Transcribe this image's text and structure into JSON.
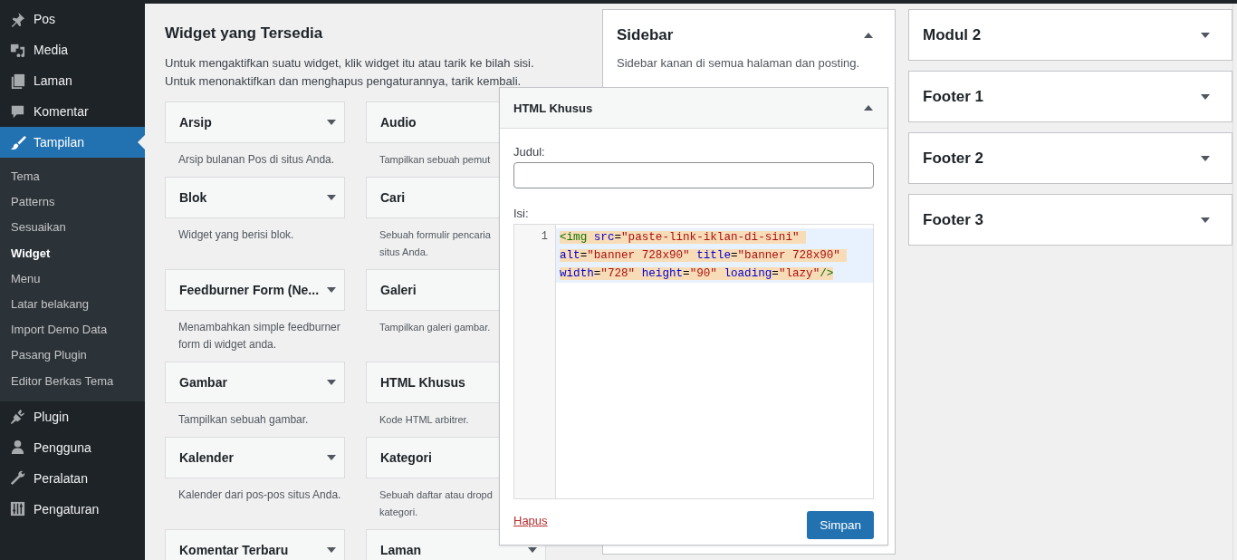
{
  "admin_menu": [
    {
      "label": "Pos",
      "selected": false
    },
    {
      "label": "Media",
      "selected": false
    },
    {
      "label": "Laman",
      "selected": false
    },
    {
      "label": "Komentar",
      "selected": false
    },
    {
      "label": "Tampilan",
      "selected": true,
      "children": [
        {
          "label": "Tema",
          "selected": false
        },
        {
          "label": "Patterns",
          "selected": false
        },
        {
          "label": "Sesuaikan",
          "selected": false
        },
        {
          "label": "Widget",
          "selected": true
        },
        {
          "label": "Menu",
          "selected": false
        },
        {
          "label": "Latar belakang",
          "selected": false
        },
        {
          "label": "Import Demo Data",
          "selected": false
        },
        {
          "label": "Pasang Plugin",
          "selected": false
        },
        {
          "label": "Editor Berkas Tema",
          "selected": false
        }
      ]
    },
    {
      "label": "Plugin",
      "selected": false
    },
    {
      "label": "Pengguna",
      "selected": false
    },
    {
      "label": "Peralatan",
      "selected": false
    },
    {
      "label": "Pengaturan",
      "selected": false
    }
  ],
  "available_widgets": {
    "title": "Widget yang Tersedia",
    "description": [
      "Untuk mengaktifkan suatu widget, klik widget itu atau tarik ke bilah sisi.",
      "Untuk menonaktifkan dan menghapus pengaturannya, tarik kembali."
    ],
    "widgets": [
      {
        "name": "Arsip",
        "description": "Arsip bulanan Pos di situs Anda.",
        "expanded": false
      },
      {
        "name": "Audio",
        "description": "Tampilkan sebuah pemut"
      },
      {
        "name": "Blok",
        "description": "Widget yang berisi blok.",
        "expanded": false
      },
      {
        "name": "Cari",
        "description": "Sebuah formulir pencaria situs Anda."
      },
      {
        "name": "Feedburner Form (Ne...",
        "description": "Menambahkan simple feedburner form di widget anda.",
        "expanded": false
      },
      {
        "name": "Galeri",
        "description": "Tampilkan galeri gambar."
      },
      {
        "name": "Gambar",
        "description": "Tampilkan sebuah gambar.",
        "expanded": false
      },
      {
        "name": "HTML Khusus",
        "description": "Kode HTML arbitrer."
      },
      {
        "name": "Kalender",
        "description": "Kalender dari pos-pos situs Anda.",
        "expanded": false
      },
      {
        "name": "Kategori",
        "description": "Sebuah daftar atau dropd kategori."
      },
      {
        "name": "Komentar Terbaru",
        "expanded": false
      },
      {
        "name": "Laman",
        "expanded": false
      }
    ]
  },
  "widget_areas": [
    {
      "name": "Sidebar",
      "description": "Sidebar kanan di semua halaman dan posting.",
      "expanded": true
    },
    {
      "name": "Modul 2",
      "expanded": false
    },
    {
      "name": "Footer 1",
      "expanded": false
    },
    {
      "name": "Footer 2",
      "expanded": false
    },
    {
      "name": "Footer 3",
      "expanded": false
    }
  ],
  "widget_editor": {
    "title": "HTML Khusus",
    "expanded": true,
    "title_label": "Judul:",
    "content_label": "Isi:",
    "code": {
      "line_number": "1",
      "selected": true,
      "tokens": [
        {
          "kind": "tag",
          "text": "<img"
        },
        {
          "kind": "attr",
          "text": " src"
        },
        {
          "kind": "plain",
          "text": "="
        },
        {
          "kind": "string",
          "text": "\"paste-link-iklan-di-sini\""
        },
        {
          "kind": "attr",
          "text": " alt"
        },
        {
          "kind": "plain",
          "text": "="
        },
        {
          "kind": "string",
          "text": "\"banner 728x90\""
        },
        {
          "kind": "attr",
          "text": " title"
        },
        {
          "kind": "plain",
          "text": "="
        },
        {
          "kind": "string",
          "text": "\"banner 728x90\""
        },
        {
          "kind": "attr",
          "text": " width"
        },
        {
          "kind": "plain",
          "text": "="
        },
        {
          "kind": "string",
          "text": "\"728\""
        },
        {
          "kind": "attr",
          "text": " height"
        },
        {
          "kind": "plain",
          "text": "="
        },
        {
          "kind": "string",
          "text": "\"90\""
        },
        {
          "kind": "attr",
          "text": " loading"
        },
        {
          "kind": "plain",
          "text": "="
        },
        {
          "kind": "string",
          "text": "\"lazy\""
        },
        {
          "kind": "tag",
          "text": "/>"
        }
      ]
    },
    "delete_link": "Hapus",
    "save_button": "Simpan"
  }
}
